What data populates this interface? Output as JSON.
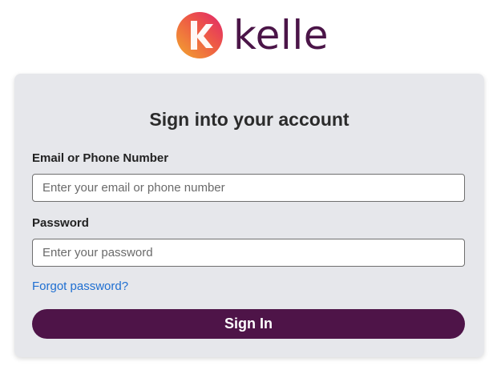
{
  "brand": {
    "name": "kelle",
    "logo_icon": "kelle-k-logo-icon",
    "colors": {
      "wordmark": "#4b1548",
      "logo_gradient_start": "#f0a030",
      "logo_gradient_end": "#e0286a"
    }
  },
  "login": {
    "title": "Sign into your account",
    "email_label": "Email or Phone Number",
    "email_placeholder": "Enter your email or phone number",
    "email_value": "",
    "password_label": "Password",
    "password_placeholder": "Enter your password",
    "password_value": "",
    "forgot_password_label": "Forgot password?",
    "submit_label": "Sign In"
  },
  "colors": {
    "card_background": "#e6e7eb",
    "primary_button": "#4e1448",
    "link": "#1f6fd1"
  }
}
